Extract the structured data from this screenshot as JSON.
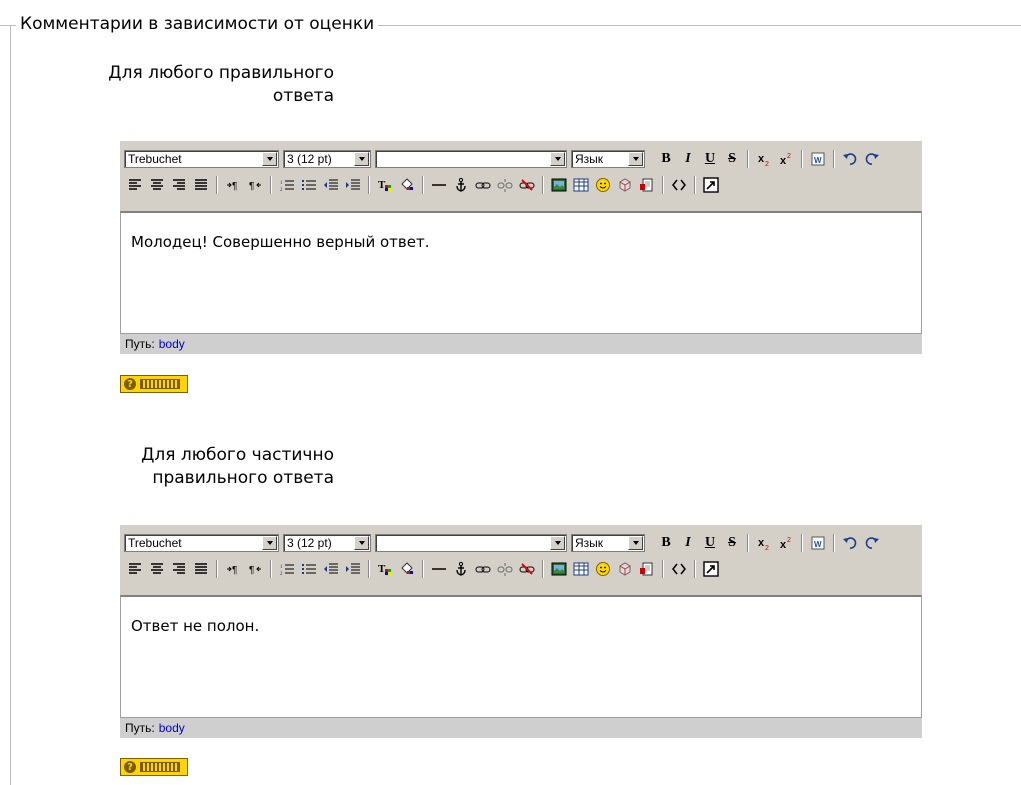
{
  "legend": "Комментарии в зависимости от оценки",
  "editors": [
    {
      "label_line1": "Для любого правильного",
      "label_line2": "ответа",
      "font_select": "Trebuchet",
      "size_select": "3 (12 pt)",
      "format_select": "",
      "lang_select": "Язык",
      "content": "Молодец! Совершенно верный ответ.",
      "path_label": "Путь:",
      "path_value": "body"
    },
    {
      "label_line1": "Для любого частично",
      "label_line2": "правильного ответа",
      "font_select": "Trebuchet",
      "size_select": "3 (12 pt)",
      "format_select": "",
      "lang_select": "Язык",
      "content": "Ответ не полон.",
      "path_label": "Путь:",
      "path_value": "body"
    }
  ],
  "toolbar": {
    "bold": "B",
    "italic": "I",
    "underline": "U",
    "strike": "S"
  },
  "colors": {
    "toolbar_bg": "#d4d0c8",
    "path_bg": "#cfcfcf",
    "link": "#0000cc",
    "help_bg": "#ffd400"
  }
}
